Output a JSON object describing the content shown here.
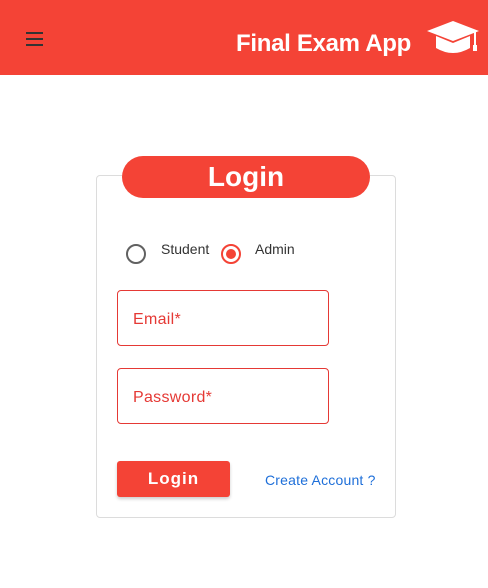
{
  "colors": {
    "primary": "#f44336",
    "link": "#1e6fd9"
  },
  "header": {
    "title": "Final Exam App",
    "menu_icon": "hamburger-menu-icon",
    "logo_icon": "graduation-cap-icon"
  },
  "login": {
    "heading": "Login",
    "roles": [
      {
        "label": "Student",
        "selected": false
      },
      {
        "label": "Admin",
        "selected": true
      }
    ],
    "email_placeholder": "Email*",
    "password_placeholder": "Password*",
    "submit_label": "Login",
    "create_account_link": "Create Account ?"
  }
}
